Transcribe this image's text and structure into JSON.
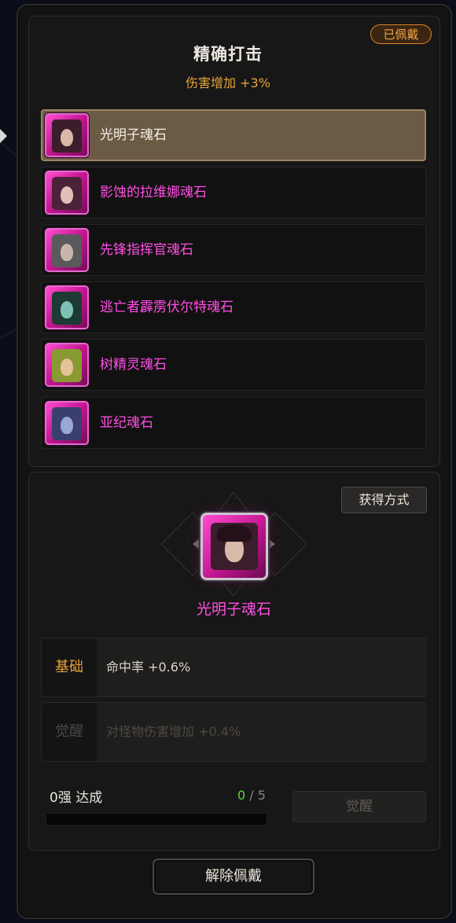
{
  "header": {
    "equipped_badge": "已佩戴",
    "title": "精确打击",
    "effect": "伤害增加  +3%"
  },
  "soul_stones": [
    {
      "label": "光明子魂石",
      "selected": true,
      "tint": "#3b1e2c",
      "skin": "#d9b9a8"
    },
    {
      "label": "影蚀的拉维娜魂石",
      "selected": false,
      "tint": "#4b2238",
      "skin": "#e0c0b8"
    },
    {
      "label": "先锋指挥官魂石",
      "selected": false,
      "tint": "#5a5a5c",
      "skin": "#c8b6ae"
    },
    {
      "label": "逃亡者霹雳伏尔特魂石",
      "selected": false,
      "tint": "#1d3a34",
      "skin": "#7ec0b4"
    },
    {
      "label": "树精灵魂石",
      "selected": false,
      "tint": "#8a9a32",
      "skin": "#e4c39a"
    },
    {
      "label": "亚纪魂石",
      "selected": false,
      "tint": "#3a3f6e",
      "skin": "#9aa6d4"
    }
  ],
  "detail": {
    "acquire_button": "获得方式",
    "name": "光明子魂石",
    "stats": [
      {
        "key": "基础",
        "value": "命中率 +0.6%",
        "active": true
      },
      {
        "key": "觉醒",
        "value": "对怪物伤害增加 +0.4%",
        "active": false
      }
    ],
    "progress_label": "0强 达成",
    "progress_current": "0",
    "progress_sep": " / ",
    "progress_max": "5",
    "progress_fraction": 0,
    "awaken_button": "觉醒"
  },
  "footer": {
    "unequip_button": "解除佩戴"
  },
  "colors": {
    "accent_orange": "#e8a437",
    "rarity_magenta": "#ff4ee5",
    "progress_green": "#5fd43a"
  },
  "icons": [
    "left-chevron-icon",
    "right-chevron-icon",
    "diamond-frame-icon"
  ]
}
